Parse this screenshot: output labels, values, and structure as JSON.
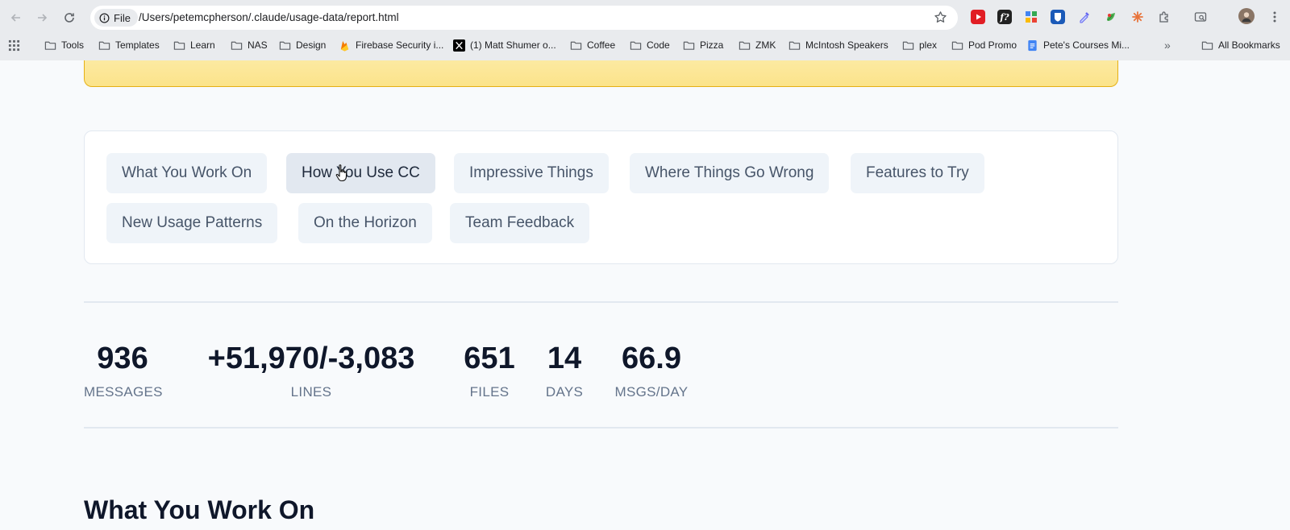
{
  "browser": {
    "file_chip": "File",
    "url": "/Users/petemcpherson/.claude/usage-data/report.html",
    "extensions": [
      "youtube-icon",
      "fontface-icon",
      "puzzle-grid-icon",
      "bitwarden-icon",
      "eyedropper-icon",
      "leaf-icon",
      "asterisk-icon",
      "extensions-icon"
    ],
    "bookmarks": [
      {
        "label": "Tools",
        "icon": "folder-icon"
      },
      {
        "label": "Templates",
        "icon": "folder-icon"
      },
      {
        "label": "Learn",
        "icon": "folder-icon"
      },
      {
        "label": "NAS",
        "icon": "folder-icon"
      },
      {
        "label": "Design",
        "icon": "folder-icon"
      },
      {
        "label": "Firebase Security i...",
        "icon": "firebase-icon"
      },
      {
        "label": "(1) Matt Shumer o...",
        "icon": "x-icon"
      },
      {
        "label": "Coffee",
        "icon": "folder-icon"
      },
      {
        "label": "Code",
        "icon": "folder-icon"
      },
      {
        "label": "Pizza",
        "icon": "folder-icon"
      },
      {
        "label": "ZMK",
        "icon": "folder-icon"
      },
      {
        "label": "McIntosh Speakers",
        "icon": "folder-icon"
      },
      {
        "label": "plex",
        "icon": "folder-icon"
      },
      {
        "label": "Pod Promo",
        "icon": "folder-icon"
      },
      {
        "label": "Pete's Courses Mi...",
        "icon": "docs-icon"
      }
    ],
    "more_bookmarks": "»",
    "all_bookmarks": "All Bookmarks"
  },
  "nav": {
    "tabs": [
      "What You Work On",
      "How You Use CC",
      "Impressive Things",
      "Where Things Go Wrong",
      "Features to Try",
      "New Usage Patterns",
      "On the Horizon",
      "Team Feedback"
    ],
    "hovered_tab": "How You Use CC"
  },
  "stats": [
    {
      "value": "936",
      "label": "MESSAGES"
    },
    {
      "value": "+51,970/-3,083",
      "label": "LINES"
    },
    {
      "value": "651",
      "label": "FILES"
    },
    {
      "value": "14",
      "label": "DAYS"
    },
    {
      "value": "66.9",
      "label": "MSGS/DAY"
    }
  ],
  "section": {
    "title": "What You Work On"
  },
  "colors": {
    "banner": "#fbe38a",
    "banner_border": "#e5b014",
    "tab_bg": "#eff4f9",
    "tab_hover_bg": "#e2e8f0",
    "heading": "#0f172a",
    "muted": "#64748b"
  }
}
